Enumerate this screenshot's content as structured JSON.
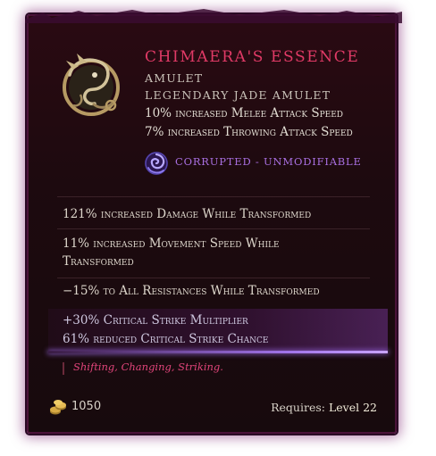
{
  "item": {
    "name": "Chimaera's Essence",
    "subtype": "Amulet",
    "base_type": "Legendary Jade Amulet",
    "implicits": [
      "10% increased Melee Attack Speed",
      "7% increased Throwing Attack Speed"
    ],
    "corruption_status": "Corrupted - Unmodifiable",
    "affixes": [
      "121% increased Damage While Transformed",
      "11% increased Movement Speed While Transformed",
      "−15% to All Resistances While Transformed"
    ],
    "sealed_affixes": [
      "+30% Critical Strike Multiplier",
      "61% reduced Critical Strike Chance"
    ],
    "lore": "Shifting, Changing, Striking.",
    "gold_value": "1050",
    "requires_label": "Requires:",
    "requires_level": "Level 22",
    "icon": "chimaera-amulet-icon",
    "corruption_icon": "corruption-vortex-icon",
    "gold_icon": "gold-coins-icon"
  },
  "colors": {
    "name": "#e03a66",
    "corrupted": "#a86fe0",
    "lore": "#e0447a",
    "background": "#1d0a0f",
    "frame": "#4a1238"
  }
}
